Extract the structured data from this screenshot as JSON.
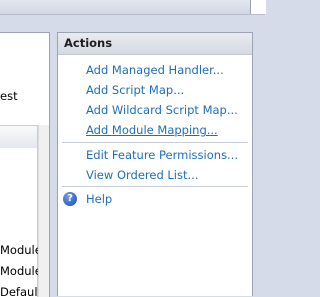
{
  "left_pane": {
    "text_fragment": "est",
    "rows": [
      "Module",
      "Module",
      "Default"
    ]
  },
  "actions": {
    "header": "Actions",
    "links": [
      "Add Managed Handler...",
      "Add Script Map...",
      "Add Wildcard Script Map...",
      "Add Module Mapping...",
      "Edit Feature Permissions...",
      "View Ordered List..."
    ],
    "help_label": "Help",
    "help_icon": "help-icon"
  },
  "colors": {
    "link": "#1e6fb8",
    "pane_border": "#9ba3b5",
    "background": "#d6dbe9"
  }
}
